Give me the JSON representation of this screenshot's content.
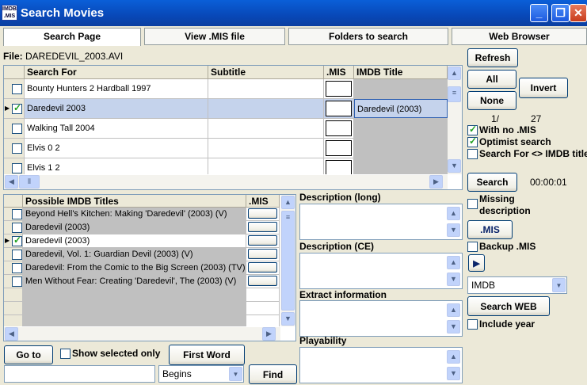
{
  "window": {
    "title": "Search Movies",
    "icon_text": "IMDB .MIS"
  },
  "tabs": [
    {
      "label": "Search Page",
      "active": true
    },
    {
      "label": "View .MIS file"
    },
    {
      "label": "Folders to search"
    },
    {
      "label": "Web Browser"
    }
  ],
  "file": {
    "label": "File:",
    "value": "DAREDEVIL_2003.AVI"
  },
  "search_grid": {
    "columns": [
      "Search For",
      "Subtitle",
      ".MIS",
      "IMDB Title"
    ],
    "rows": [
      {
        "checked": false,
        "search_for": "Bounty Hunters 2  Hardball 1997",
        "subtitle": "",
        "mis": "",
        "imdb": "",
        "selected": false
      },
      {
        "checked": true,
        "search_for": "Daredevil 2003",
        "subtitle": "",
        "mis": "",
        "imdb": "Daredevil (2003)",
        "selected": true
      },
      {
        "checked": false,
        "search_for": "Walking Tall 2004",
        "subtitle": "",
        "mis": "",
        "imdb": "",
        "selected": false
      },
      {
        "checked": false,
        "search_for": "Elvis 0 2",
        "subtitle": "",
        "mis": "",
        "imdb": "",
        "selected": false
      },
      {
        "checked": false,
        "search_for": "Elvis 1 2",
        "subtitle": "",
        "mis": "",
        "imdb": "",
        "selected": false
      }
    ]
  },
  "right_panel": {
    "refresh": "Refresh",
    "all": "All",
    "invert": "Invert",
    "none": "None",
    "counter_current": "1/",
    "counter_total": "27",
    "with_no_mis": {
      "label": "With no .MIS",
      "checked": true
    },
    "optimist": {
      "label": "Optimist search",
      "checked": true
    },
    "search_diff": {
      "label": "Search For <> IMDB title",
      "checked": false
    },
    "search": "Search",
    "timer": "00:00:01",
    "missing_desc": {
      "label": "Missing description",
      "checked": false
    },
    "mis_btn": ".MIS",
    "backup": {
      "label": "Backup .MIS",
      "checked": false
    },
    "source_select": "IMDB",
    "search_web": "Search WEB",
    "include_year": {
      "label": "Include year",
      "checked": false
    }
  },
  "imdb_grid": {
    "columns": [
      "Possible IMDB Titles",
      ".MIS"
    ],
    "rows": [
      {
        "checked": false,
        "title": "Beyond Hell's Kitchen: Making 'Daredevil' (2003) (V)"
      },
      {
        "checked": false,
        "title": "Daredevil (2003)"
      },
      {
        "checked": true,
        "title": "Daredevil (2003)"
      },
      {
        "checked": false,
        "title": "Daredevil, Vol. 1: Guardian Devil (2003) (V)"
      },
      {
        "checked": false,
        "title": "Daredevil: From the Comic to the Big Screen (2003) (TV)"
      },
      {
        "checked": false,
        "title": "Men Without Fear: Creating 'Daredevil', The (2003) (V)"
      }
    ]
  },
  "descriptions": {
    "long": "Description (long)",
    "ce": "Description (CE)",
    "extract": "Extract information",
    "playability": "Playability"
  },
  "bottom": {
    "goto": "Go to",
    "show_selected": {
      "label": "Show selected only",
      "checked": false
    },
    "first_word": "First Word",
    "match_select": "Begins",
    "find": "Find",
    "find_input": ""
  }
}
